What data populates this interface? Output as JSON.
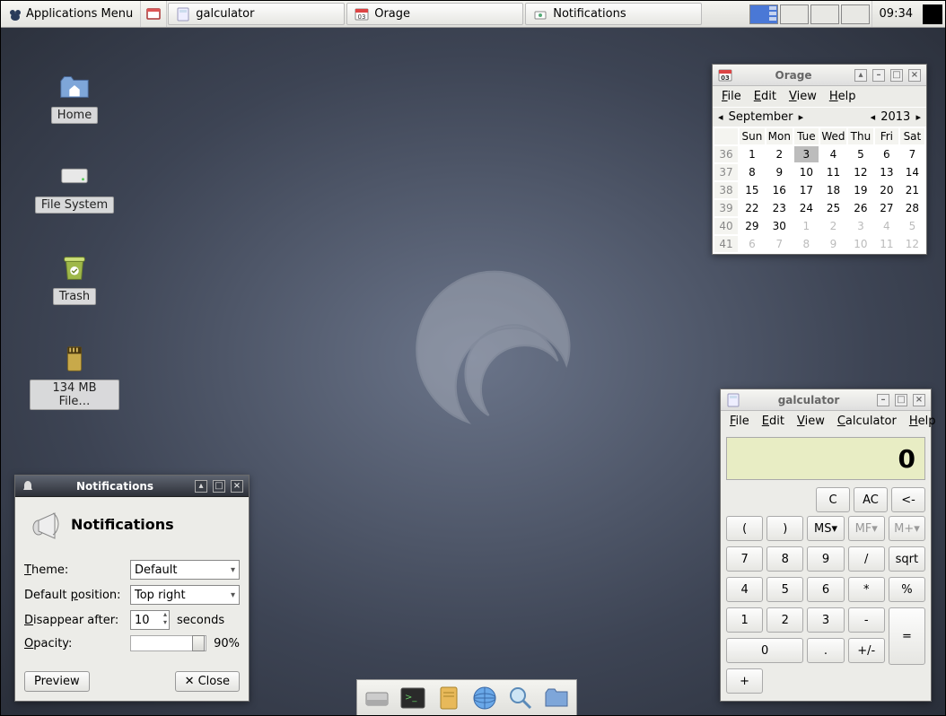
{
  "panel": {
    "apps_label": "Applications Menu",
    "tasks": [
      {
        "label": "galculator",
        "icon": "calc-icon"
      },
      {
        "label": "Orage",
        "icon": "calendar-icon"
      },
      {
        "label": "Notifications",
        "icon": "prefs-icon"
      }
    ],
    "clock": "09:34"
  },
  "desktop": {
    "icons": [
      {
        "label": "Home",
        "icon": "folder-home-icon"
      },
      {
        "label": "File System",
        "icon": "drive-icon"
      },
      {
        "label": "Trash",
        "icon": "trash-icon"
      },
      {
        "label": "134 MB File…",
        "icon": "sd-card-icon"
      }
    ]
  },
  "orage": {
    "title": "Orage",
    "menus": [
      "File",
      "Edit",
      "View",
      "Help"
    ],
    "month": "September",
    "year": "2013",
    "day_headers": [
      "Sun",
      "Mon",
      "Tue",
      "Wed",
      "Thu",
      "Fri",
      "Sat"
    ],
    "weeks": [
      {
        "wk": 36,
        "days": [
          1,
          2,
          3,
          4,
          5,
          6,
          7
        ],
        "today_idx": 2
      },
      {
        "wk": 37,
        "days": [
          8,
          9,
          10,
          11,
          12,
          13,
          14
        ]
      },
      {
        "wk": 38,
        "days": [
          15,
          16,
          17,
          18,
          19,
          20,
          21
        ]
      },
      {
        "wk": 39,
        "days": [
          22,
          23,
          24,
          25,
          26,
          27,
          28
        ]
      },
      {
        "wk": 40,
        "days": [
          29,
          30,
          1,
          2,
          3,
          4,
          5
        ],
        "dim_from": 2
      },
      {
        "wk": 41,
        "days": [
          6,
          7,
          8,
          9,
          10,
          11,
          12
        ],
        "dim_from": 0
      }
    ]
  },
  "calc": {
    "title": "galculator",
    "menus": [
      "File",
      "Edit",
      "View",
      "Calculator",
      "Help"
    ],
    "display": "0",
    "top_row": [
      "C",
      "AC",
      "<-"
    ],
    "sec_row": [
      {
        "l": "(",
        "dim": false
      },
      {
        "l": ")",
        "dim": false
      },
      {
        "l": "MS▾",
        "dim": false
      },
      {
        "l": "MF▾",
        "dim": true
      },
      {
        "l": "M+▾",
        "dim": true
      }
    ],
    "keys": [
      "7",
      "8",
      "9",
      "/",
      "sqrt",
      "4",
      "5",
      "6",
      "*",
      "%",
      "1",
      "2",
      "3",
      "-",
      "=",
      "0",
      ".",
      "+/-",
      "+"
    ]
  },
  "notif": {
    "title": "Notifications",
    "heading": "Notifications",
    "theme_label": "Theme:",
    "theme_value": "Default",
    "pos_label": "Default position:",
    "pos_value": "Top right",
    "disappear_label": "Disappear after:",
    "disappear_value": "10",
    "disappear_unit": "seconds",
    "opacity_label": "Opacity:",
    "opacity_text": "90%",
    "opacity_pct": 90,
    "preview": "Preview",
    "close": "Close"
  },
  "dock": {
    "items": [
      "file-manager-icon",
      "terminal-icon",
      "notes-icon",
      "web-browser-icon",
      "search-icon",
      "folder-icon"
    ]
  }
}
